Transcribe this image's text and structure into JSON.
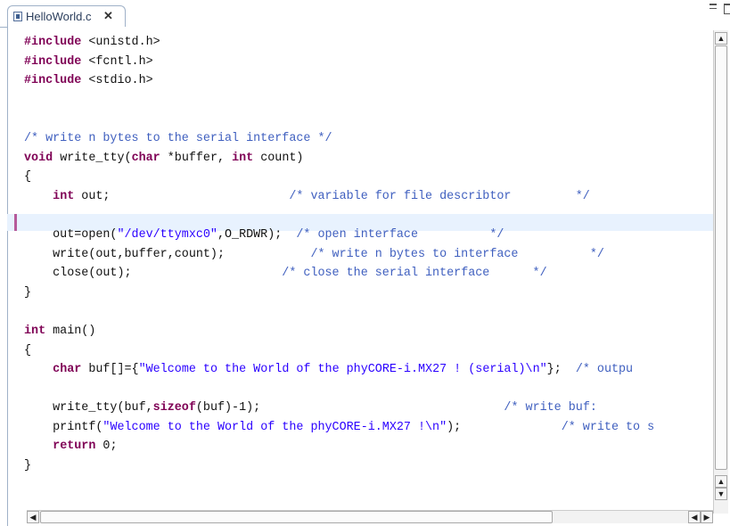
{
  "tab": {
    "title": "HelloWorld.c",
    "close_glyph": "✕",
    "icon": "c-source-file-icon"
  },
  "window_controls": [
    "minimize-icon",
    "maximize-icon"
  ],
  "colors": {
    "keyword": "#7f0055",
    "comment": "#3f5fbf",
    "string": "#2a00ff",
    "current_line": "#e8f2fe",
    "gutter_marker": "#b65a9a"
  },
  "code": {
    "lines": [
      [
        {
          "t": "#include",
          "c": "kw"
        },
        {
          "t": " <unistd.h>"
        }
      ],
      [
        {
          "t": "#include",
          "c": "kw"
        },
        {
          "t": " <fcntl.h>"
        }
      ],
      [
        {
          "t": "#include",
          "c": "kw"
        },
        {
          "t": " <stdio.h>"
        }
      ],
      [],
      [],
      [
        {
          "t": "/* write n bytes to the serial interface */",
          "c": "cm"
        }
      ],
      [
        {
          "t": "void",
          "c": "kw"
        },
        {
          "t": " write_tty("
        },
        {
          "t": "char",
          "c": "kw"
        },
        {
          "t": " *buffer, "
        },
        {
          "t": "int",
          "c": "kw"
        },
        {
          "t": " count)"
        }
      ],
      [
        {
          "t": "{"
        }
      ],
      [
        {
          "t": "    "
        },
        {
          "t": "int",
          "c": "kw"
        },
        {
          "t": " out;                         "
        },
        {
          "t": "/* variable for file describtor         */",
          "c": "cm"
        }
      ],
      [],
      [
        {
          "t": "    out=open("
        },
        {
          "t": "\"/dev/ttymxc0\"",
          "c": "st"
        },
        {
          "t": ",O_RDWR);  "
        },
        {
          "t": "/* open interface          */",
          "c": "cm"
        }
      ],
      [
        {
          "t": "    write(out,buffer,count);            "
        },
        {
          "t": "/* write n bytes to interface          */",
          "c": "cm"
        }
      ],
      [
        {
          "t": "    close(out);                     "
        },
        {
          "t": "/* close the serial interface      */",
          "c": "cm"
        }
      ],
      [
        {
          "t": "}"
        }
      ],
      [],
      [
        {
          "t": "int",
          "c": "kw"
        },
        {
          "t": " main()"
        }
      ],
      [
        {
          "t": "{"
        }
      ],
      [
        {
          "t": "    "
        },
        {
          "t": "char",
          "c": "kw"
        },
        {
          "t": " buf[]={"
        },
        {
          "t": "\"Welcome to the World of the phyCORE-i.MX27 ! (serial)\\n\"",
          "c": "st"
        },
        {
          "t": "};  "
        },
        {
          "t": "/* outpu",
          "c": "cm"
        }
      ],
      [],
      [
        {
          "t": "    write_tty(buf,"
        },
        {
          "t": "sizeof",
          "c": "kw"
        },
        {
          "t": "(buf)-1);                                  "
        },
        {
          "t": "/* write buf:",
          "c": "cm"
        }
      ],
      [
        {
          "t": "    printf("
        },
        {
          "t": "\"Welcome to the World of the phyCORE-i.MX27 !\\n\"",
          "c": "st"
        },
        {
          "t": ");              "
        },
        {
          "t": "/* write to s",
          "c": "cm"
        }
      ],
      [
        {
          "t": "    "
        },
        {
          "t": "return",
          "c": "kw"
        },
        {
          "t": " 0;"
        }
      ],
      [
        {
          "t": "}"
        }
      ]
    ]
  },
  "scrollbars": {
    "vertical": {
      "up": "scroll-up-icon",
      "down": "scroll-down-icon"
    },
    "horizontal": {
      "left": "scroll-left-icon",
      "right": "scroll-right-icon"
    }
  }
}
